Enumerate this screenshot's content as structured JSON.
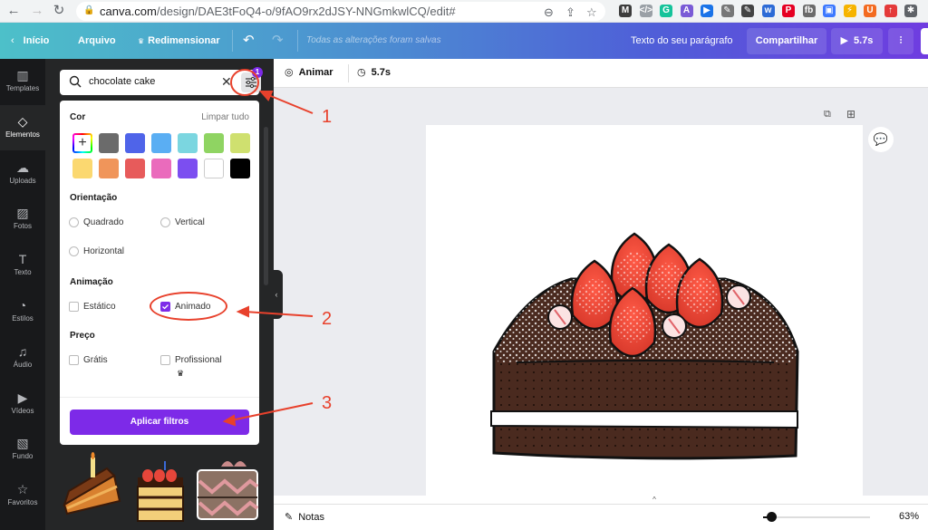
{
  "browser": {
    "url_domain": "canva.com",
    "url_path": "/design/DAE3tFoQ4-o/9fAO9rx2dJSY-NNGmkwlCQ/edit#",
    "extensions": [
      {
        "name": "m-ext",
        "label": "M",
        "color": "#3c3c3c"
      },
      {
        "name": "code-ext",
        "label": "</>",
        "color": "#9aa0a6"
      },
      {
        "name": "grammarly-ext",
        "label": "G",
        "color": "#15c39a"
      },
      {
        "name": "chart-ext",
        "label": "A",
        "color": "#7a5bd6"
      },
      {
        "name": "play-ext",
        "label": "▶",
        "color": "#1a73e8"
      },
      {
        "name": "eyedropper-ext",
        "label": "✎",
        "color": "#777777"
      },
      {
        "name": "colorpicker-ext",
        "label": "✎",
        "color": "#444444"
      },
      {
        "name": "wp-ext",
        "label": "w",
        "color": "#2d6bd6"
      },
      {
        "name": "pinterest-ext",
        "label": "P",
        "color": "#e60023"
      },
      {
        "name": "fb-ext",
        "label": "fb",
        "color": "#6b6b6b"
      },
      {
        "name": "card-ext",
        "label": "▣",
        "color": "#3c78ff"
      },
      {
        "name": "bolt-ext",
        "label": "⚡",
        "color": "#f6b400"
      },
      {
        "name": "u-ext",
        "label": "U",
        "color": "#f36b21"
      },
      {
        "name": "upload-ext",
        "label": "↑",
        "color": "#e43a3a"
      },
      {
        "name": "puzzle-ext",
        "label": "✱",
        "color": "#5f6368"
      }
    ]
  },
  "header": {
    "home": "Início",
    "file": "Arquivo",
    "resize": "Redimensionar",
    "status": "Todas as alterações foram salvas",
    "doc_title": "Texto do seu parágrafo",
    "share": "Compartilhar",
    "play_duration": "5.7s"
  },
  "sidebar": {
    "items": [
      {
        "label": "Templates",
        "icon": "templates-icon"
      },
      {
        "label": "Elementos",
        "icon": "elements-icon",
        "active": true
      },
      {
        "label": "Uploads",
        "icon": "upload-cloud-icon"
      },
      {
        "label": "Fotos",
        "icon": "photo-icon"
      },
      {
        "label": "Texto",
        "icon": "text-icon"
      },
      {
        "label": "Estilos",
        "icon": "palette-icon"
      },
      {
        "label": "Áudio",
        "icon": "music-icon"
      },
      {
        "label": "Vídeos",
        "icon": "video-icon"
      },
      {
        "label": "Fundo",
        "icon": "background-icon"
      },
      {
        "label": "Favoritos",
        "icon": "star-icon"
      }
    ]
  },
  "panel": {
    "search_value": "chocolate cake",
    "filter_badge": "1",
    "filters": {
      "color_title": "Cor",
      "clear_all": "Limpar tudo",
      "colors": [
        "#6b6b6b",
        "#4f64e9",
        "#5aaef3",
        "#7bd6e0",
        "#8fd462",
        "#cfe06f",
        "#fbd870",
        "#f0955a",
        "#e75b5b",
        "#ea6bbc",
        "#7c4ef0",
        "#ffffff",
        "#000000"
      ],
      "orientation_title": "Orientação",
      "orientation_options": [
        {
          "label": "Quadrado",
          "selected": false
        },
        {
          "label": "Vertical",
          "selected": false
        },
        {
          "label": "Horizontal",
          "selected": false
        }
      ],
      "animation_title": "Animação",
      "animation_options": [
        {
          "label": "Estático",
          "checked": false
        },
        {
          "label": "Animado",
          "checked": true
        }
      ],
      "price_title": "Preço",
      "price_options": [
        {
          "label": "Grátis",
          "checked": false
        },
        {
          "label": "Profissional",
          "checked": false
        }
      ],
      "apply": "Aplicar filtros"
    }
  },
  "editor_toolbar": {
    "animate": "Animar",
    "duration": "5.7s"
  },
  "footer": {
    "notes": "Notas",
    "zoom": "63%",
    "zoom_fraction": 0.08
  },
  "annotations": [
    "1",
    "2",
    "3"
  ],
  "colors": {
    "accent": "#7d2ae8",
    "annotation": "#e8412c"
  }
}
